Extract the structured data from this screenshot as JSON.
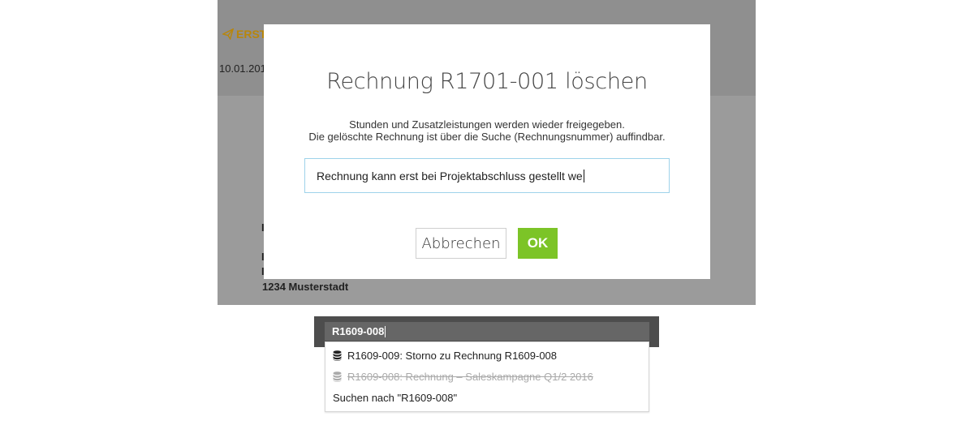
{
  "background": {
    "brand_label": "ERST",
    "date": "10.01.201",
    "address_lines": [
      "I",
      "I",
      "I",
      "1234 Musterstadt"
    ]
  },
  "modal": {
    "title": "Rechnung R1701-001 löschen",
    "description_line1": "Stunden und Zusatzleistungen werden wieder freigegeben.",
    "description_line2": "Die gelöschte Rechnung ist über die Suche (Rechnungsnummer) auffindbar.",
    "reason_value": "Rechnung kann erst bei Projektabschluss gestellt we",
    "cancel_label": "Abbrechen",
    "ok_label": "OK",
    "accent_color": "#7cc427",
    "brand_color": "#b8860b"
  },
  "search": {
    "query": "R1609-008",
    "results": [
      {
        "label": "R1609-009: Storno zu Rechnung R1609-008",
        "icon": "database-icon",
        "disabled": false
      },
      {
        "label": "R1609-008: Rechnung – Saleskampagne Q1/2 2016",
        "icon": "database-icon",
        "disabled": true
      }
    ],
    "search_for_label": "Suchen nach \"R1609-008\""
  }
}
